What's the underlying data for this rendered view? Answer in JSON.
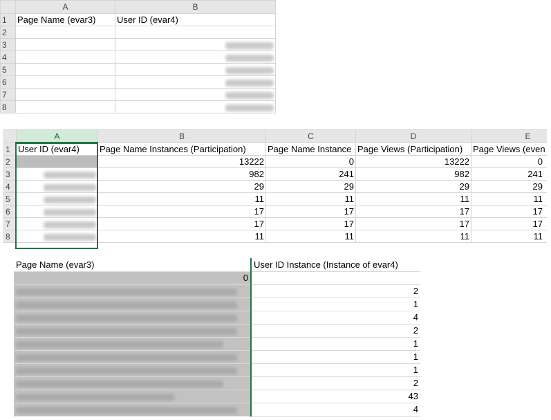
{
  "sheet1": {
    "col_headers": [
      "A",
      "B"
    ],
    "row_numbers": [
      "1",
      "2",
      "3",
      "4",
      "5",
      "6",
      "7",
      "8"
    ],
    "header_row": [
      "Page Name (evar3)",
      "User ID (evar4)"
    ]
  },
  "sheet2": {
    "col_headers": [
      "A",
      "B",
      "C",
      "D",
      "E"
    ],
    "row_numbers": [
      "1",
      "2",
      "3",
      "4",
      "5",
      "6",
      "7",
      "8"
    ],
    "header_row": [
      "User ID (evar4)",
      "Page Name Instances (Participation)",
      "Page Name Instance",
      "Page Views (Participation)",
      "Page Views (even"
    ],
    "rows": [
      [
        "13222",
        "0",
        "13222",
        "0"
      ],
      [
        "982",
        "241",
        "982",
        "241"
      ],
      [
        "29",
        "29",
        "29",
        "29"
      ],
      [
        "11",
        "11",
        "11",
        "11"
      ],
      [
        "17",
        "17",
        "17",
        "17"
      ],
      [
        "17",
        "17",
        "17",
        "17"
      ],
      [
        "11",
        "11",
        "11",
        "11"
      ]
    ]
  },
  "sheet3": {
    "header_row": [
      "Page Name (evar3)",
      "User ID Instance (Instance of evar4)"
    ],
    "first_value": "0",
    "values": [
      "2",
      "1",
      "4",
      "2",
      "1",
      "1",
      "1",
      "2",
      "43",
      "4"
    ]
  },
  "colors": {
    "selection_border": "#217346",
    "selected_header_bg": "#d2ebd9",
    "header_bg": "#e6e6e6"
  }
}
